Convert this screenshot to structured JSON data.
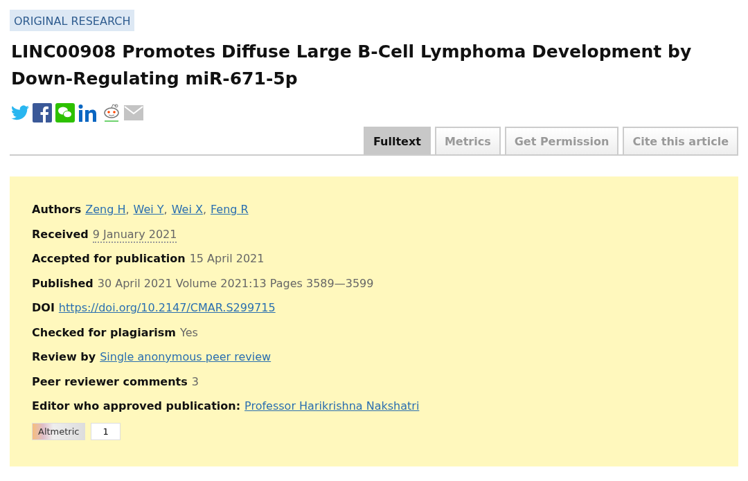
{
  "badge": "ORIGINAL RESEARCH",
  "title": "LINC00908 Promotes Diffuse Large B-Cell Lymphoma Development by Down-Regulating miR-671-5p",
  "share_icons": [
    {
      "kind": "twitter"
    },
    {
      "kind": "facebook"
    },
    {
      "kind": "wechat"
    },
    {
      "kind": "linkedin"
    },
    {
      "kind": "reddit"
    },
    {
      "kind": "email"
    }
  ],
  "tabs": [
    {
      "label": "Fulltext",
      "selected": true
    },
    {
      "label": "Metrics",
      "selected": false
    },
    {
      "label": "Get Permission",
      "selected": false
    },
    {
      "label": "Cite this article",
      "selected": false
    }
  ],
  "details": [
    {
      "label": "Authors",
      "values": [
        {
          "kind": "link",
          "text": "Zeng H"
        },
        {
          "kind": "text",
          "text": ","
        },
        {
          "kind": "link",
          "text": "Wei Y"
        },
        {
          "kind": "text",
          "text": ","
        },
        {
          "kind": "link",
          "text": "Wei X"
        },
        {
          "kind": "text",
          "text": ","
        },
        {
          "kind": "link",
          "text": "Feng R"
        }
      ]
    },
    {
      "label": "Received",
      "values": [
        {
          "kind": "dotted",
          "text": "9 January 2021"
        }
      ]
    },
    {
      "label": "Accepted for publication",
      "values": [
        {
          "kind": "text",
          "text": "15 April 2021"
        }
      ]
    },
    {
      "label": "Published",
      "values": [
        {
          "kind": "text",
          "text": "30 April 2021 Volume 2021:13 Pages 3589—3599"
        }
      ]
    },
    {
      "label": "DOI",
      "values": [
        {
          "kind": "link",
          "text": "https://doi.org/10.2147/CMAR.S299715"
        }
      ]
    },
    {
      "label": "Checked for plagiarism",
      "values": [
        {
          "kind": "text",
          "text": "Yes"
        }
      ]
    },
    {
      "label": "Review by",
      "values": [
        {
          "kind": "link",
          "text": "Single anonymous peer review"
        }
      ]
    },
    {
      "label": "Peer reviewer comments",
      "values": [
        {
          "kind": "text",
          "text": "3"
        }
      ]
    },
    {
      "label": "Editor who approved publication:",
      "values": [
        {
          "kind": "link",
          "text": "Professor Harikrishna Nakshatri"
        }
      ]
    }
  ],
  "altmetric": {
    "label": "Altmetric",
    "count": "1"
  }
}
